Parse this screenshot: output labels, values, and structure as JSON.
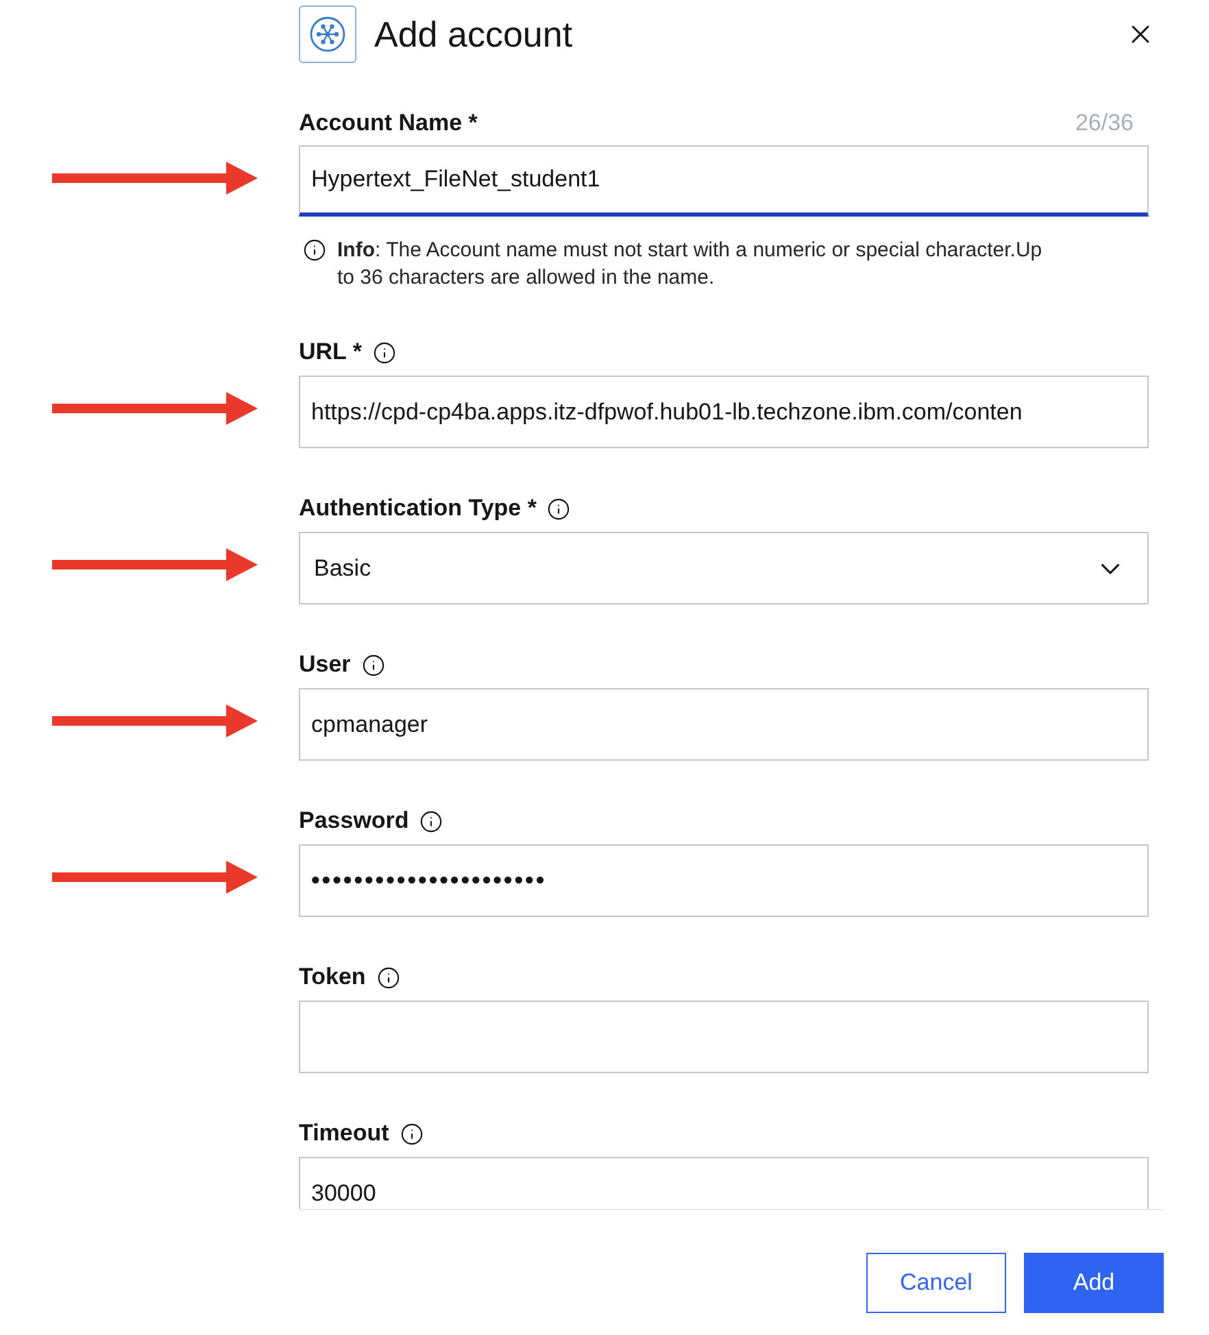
{
  "dialog": {
    "title": "Add account"
  },
  "fields": [
    {
      "kind": "text",
      "label": "Account Name *",
      "info": false,
      "counter": "26/36",
      "value": "Hypertext_FileNet_student1",
      "focused": true,
      "annotated": true,
      "helper": "**Info**: The Account name must not start with a numeric or special character.Up to 36 characters are allowed in the name."
    },
    {
      "kind": "text",
      "label": "URL *",
      "info": true,
      "value": "https://cpd-cp4ba.apps.itz-dfpwof.hub01-lb.techzone.ibm.com/conten",
      "focused": false,
      "annotated": true
    },
    {
      "kind": "select",
      "label": "Authentication Type *",
      "info": true,
      "value": "Basic",
      "focused": false,
      "annotated": true
    },
    {
      "kind": "text",
      "label": "User",
      "info": true,
      "value": "cpmanager",
      "focused": false,
      "annotated": true
    },
    {
      "kind": "password",
      "label": "Password",
      "info": true,
      "value": "••••••••••••••••••••••",
      "focused": false,
      "annotated": true
    },
    {
      "kind": "text",
      "label": "Token",
      "info": true,
      "focused": false,
      "annotated": false
    },
    {
      "kind": "text",
      "label": "Timeout",
      "info": true,
      "value": "30000",
      "focused": false,
      "annotated": false
    }
  ],
  "buttons": [
    {
      "kind": "secondary",
      "label": "Cancel"
    },
    {
      "kind": "primary",
      "label": "Add"
    }
  ]
}
